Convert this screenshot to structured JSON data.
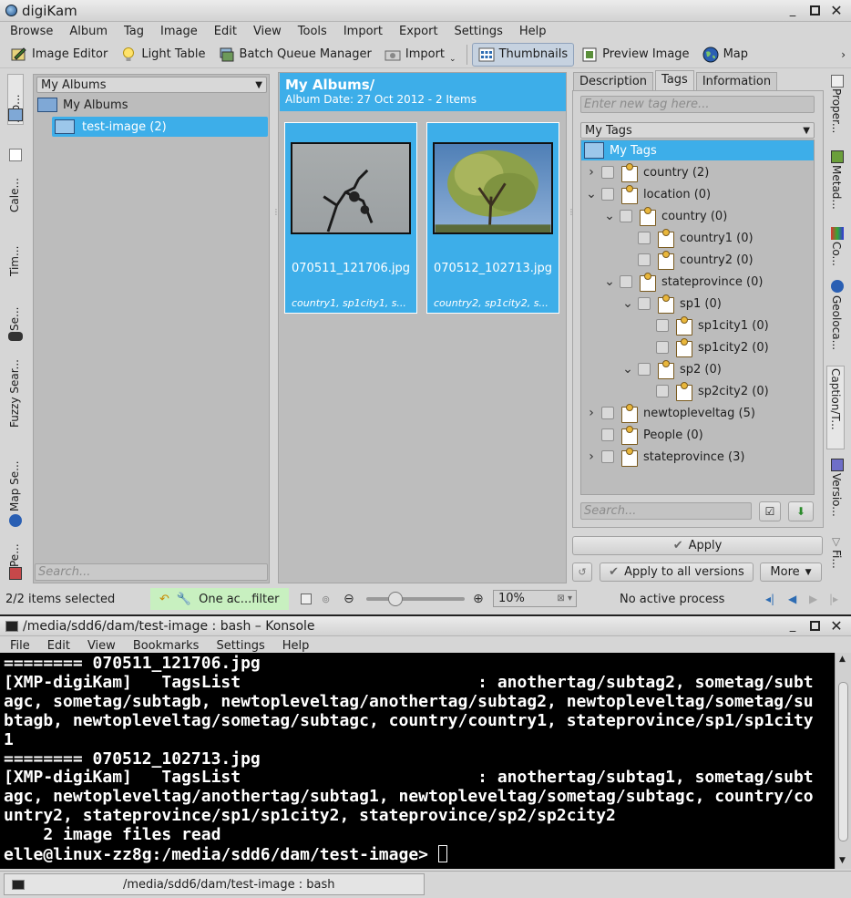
{
  "digikam": {
    "title": "digiKam",
    "menu": [
      "Browse",
      "Album",
      "Tag",
      "Image",
      "Edit",
      "View",
      "Tools",
      "Import",
      "Export",
      "Settings",
      "Help"
    ],
    "toolbar": {
      "image_editor": "Image Editor",
      "light_table": "Light Table",
      "batch_queue": "Batch Queue Manager",
      "import": "Import",
      "thumbnails": "Thumbnails",
      "preview": "Preview Image",
      "map": "Map"
    },
    "left_tabs": [
      "Alb...",
      "Cale...",
      "Tim...",
      "Se...",
      "Fuzzy Sear...",
      "Map Se...",
      "Pe..."
    ],
    "albums": {
      "combo": "My Albums",
      "root": "My Albums",
      "child": "test-image (2)",
      "search_placeholder": "Search..."
    },
    "center": {
      "header_title": "My Albums/",
      "header_sub": "Album Date: 27 Oct 2012 - 2 Items",
      "thumbs": [
        {
          "filename": "070511_121706.jpg",
          "tags": "country1, sp1city1, s..."
        },
        {
          "filename": "070512_102713.jpg",
          "tags": "country2, sp1city2, s..."
        }
      ]
    },
    "right": {
      "tabs": [
        "Description",
        "Tags",
        "Information"
      ],
      "active_tab": "Tags",
      "new_tag_placeholder": "Enter new tag here...",
      "combo": "My Tags",
      "root": "My Tags",
      "tree": [
        {
          "label": "country (2)",
          "level": 0,
          "arrow": "right"
        },
        {
          "label": "location (0)",
          "level": 0,
          "arrow": "down"
        },
        {
          "label": "country (0)",
          "level": 1,
          "arrow": "down"
        },
        {
          "label": "country1 (0)",
          "level": 2,
          "arrow": ""
        },
        {
          "label": "country2 (0)",
          "level": 2,
          "arrow": ""
        },
        {
          "label": "stateprovince (0)",
          "level": 1,
          "arrow": "down"
        },
        {
          "label": "sp1 (0)",
          "level": 2,
          "arrow": "down"
        },
        {
          "label": "sp1city1 (0)",
          "level": 3,
          "arrow": ""
        },
        {
          "label": "sp1city2 (0)",
          "level": 3,
          "arrow": ""
        },
        {
          "label": "sp2 (0)",
          "level": 2,
          "arrow": "down"
        },
        {
          "label": "sp2city2 (0)",
          "level": 3,
          "arrow": ""
        },
        {
          "label": "newtopleveltag (5)",
          "level": 0,
          "arrow": "right"
        },
        {
          "label": "People (0)",
          "level": 0,
          "arrow": ""
        },
        {
          "label": "stateprovince (3)",
          "level": 0,
          "arrow": "right"
        }
      ],
      "search_placeholder": "Search...",
      "apply": "Apply",
      "apply_all": "Apply to all versions",
      "more": "More"
    },
    "right_tabs": [
      "Proper...",
      "Metad...",
      "Co...",
      "Geoloca...",
      "Caption/T...",
      "Versio...",
      "Fi..."
    ],
    "status": {
      "selected": "2/2 items selected",
      "filter": "One ac...filter",
      "zoom": "10%",
      "process": "No active process"
    }
  },
  "konsole": {
    "title": "/media/sdd6/dam/test-image : bash – Konsole",
    "menu": [
      "File",
      "Edit",
      "View",
      "Bookmarks",
      "Settings",
      "Help"
    ],
    "lines": [
      "======== 070511_121706.jpg",
      "[XMP-digiKam]   TagsList                        : anothertag/subtag2, sometag/subt",
      "agc, sometag/subtagb, newtopleveltag/anothertag/subtag2, newtopleveltag/sometag/su",
      "btagb, newtopleveltag/sometag/subtagc, country/country1, stateprovince/sp1/sp1city",
      "1",
      "======== 070512_102713.jpg",
      "[XMP-digiKam]   TagsList                        : anothertag/subtag1, sometag/subt",
      "agc, newtopleveltag/anothertag/subtag1, newtopleveltag/sometag/subtagc, country/co",
      "untry2, stateprovince/sp1/sp1city2, stateprovince/sp2/sp2city2",
      "    2 image files read",
      "elle@linux-zz8g:/media/sdd6/dam/test-image> "
    ],
    "session_tab": "/media/sdd6/dam/test-image : bash"
  }
}
